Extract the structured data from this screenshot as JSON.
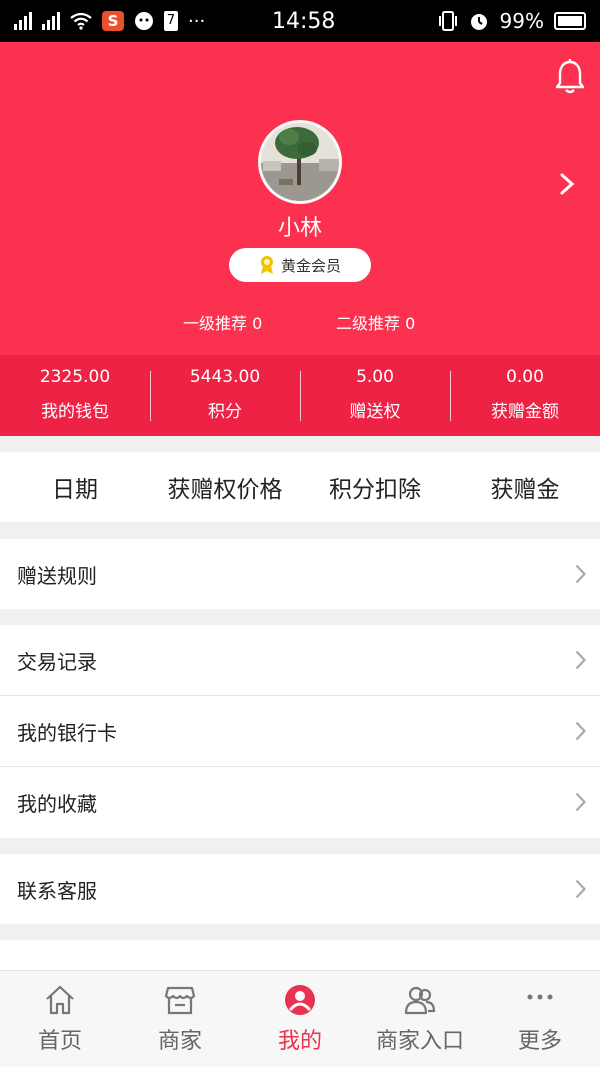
{
  "status_bar": {
    "carrier_icons": [
      "signal-icon",
      "signal-icon",
      "wifi-icon",
      "sogou-icon",
      "android-icon",
      "notification-icon"
    ],
    "time": "14:58",
    "battery": "99%",
    "badge_letter": "S",
    "badge_number": "7",
    "more": "···"
  },
  "profile": {
    "username": "小林",
    "member_level": "黄金会员",
    "referral_level1": "一级推荐 0",
    "referral_level2": "二级推荐 0"
  },
  "stats": [
    {
      "value": "2325.00",
      "label": "我的钱包"
    },
    {
      "value": "5443.00",
      "label": "积分"
    },
    {
      "value": "5.00",
      "label": "赠送权"
    },
    {
      "value": "0.00",
      "label": "获赠金额"
    }
  ],
  "table_headers": [
    "日期",
    "获赠权价格",
    "积分扣除",
    "获赠金"
  ],
  "menu": {
    "rules": "赠送规则",
    "transactions": "交易记录",
    "bank_cards": "我的银行卡",
    "favorites": "我的收藏",
    "support": "联系客服"
  },
  "tabs": [
    {
      "label": "首页",
      "icon": "home-icon"
    },
    {
      "label": "商家",
      "icon": "store-icon"
    },
    {
      "label": "我的",
      "icon": "user-icon"
    },
    {
      "label": "商家入口",
      "icon": "group-icon"
    },
    {
      "label": "更多",
      "icon": "more-icon"
    }
  ],
  "colors": {
    "header_bg": "#fc3150",
    "stats_bg": "#ee2244",
    "active_tab": "#e8324f"
  }
}
